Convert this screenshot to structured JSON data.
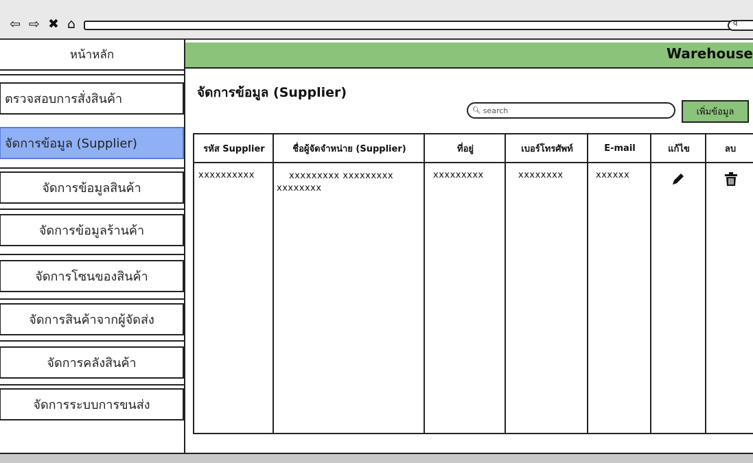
{
  "browser": {
    "nav_glyphs": [
      "⇦",
      "⇨",
      "✖",
      "⌂"
    ],
    "search_glyph": "q"
  },
  "sidebar": {
    "home": "หน้าหลัก",
    "items": [
      {
        "label": "ตรวจสอบการสั่งสินค้า",
        "active": false
      },
      {
        "label": "จัดการข้อมูล (Supplier)",
        "active": true
      },
      {
        "label": "จัดการข้อมูลสินค้า",
        "active": false
      },
      {
        "label": "จัดการข้อมูลร้านค้า",
        "active": false
      },
      {
        "label": "จัดการโซนของสินค้า",
        "active": false
      },
      {
        "label": "จัดการสินค้าจากผู้จัดส่ง",
        "active": false
      },
      {
        "label": "จัดการคลังสินค้า",
        "active": false
      },
      {
        "label": "จัดการระบบการขนส่ง",
        "active": false
      }
    ]
  },
  "header": {
    "brand": "Warehouse",
    "accent_color": "#8bc37a"
  },
  "main": {
    "title": "จัดการข้อมูล (Supplier)",
    "search": {
      "placeholder": "search",
      "icon": "search-icon"
    },
    "add_button": "เพิ่มข้อมูล"
  },
  "table": {
    "columns": [
      "รหัส Supplier",
      "ชื่อผู้จัดจำหน่าย (Supplier)",
      "ที่อยู่",
      "เบอร์โทรศัพท์",
      "E-mail",
      "แก้ไข",
      "ลบ"
    ],
    "rows": [
      {
        "code": "xxxxxxxxxx",
        "name": "xxxxxxxxx xxxxxxxxx xxxxxxxx",
        "address": "xxxxxxxxx",
        "phone": "xxxxxxxx",
        "email": "xxxxxx",
        "edit_icon": "pencil-icon",
        "delete_icon": "trash-icon"
      }
    ]
  }
}
